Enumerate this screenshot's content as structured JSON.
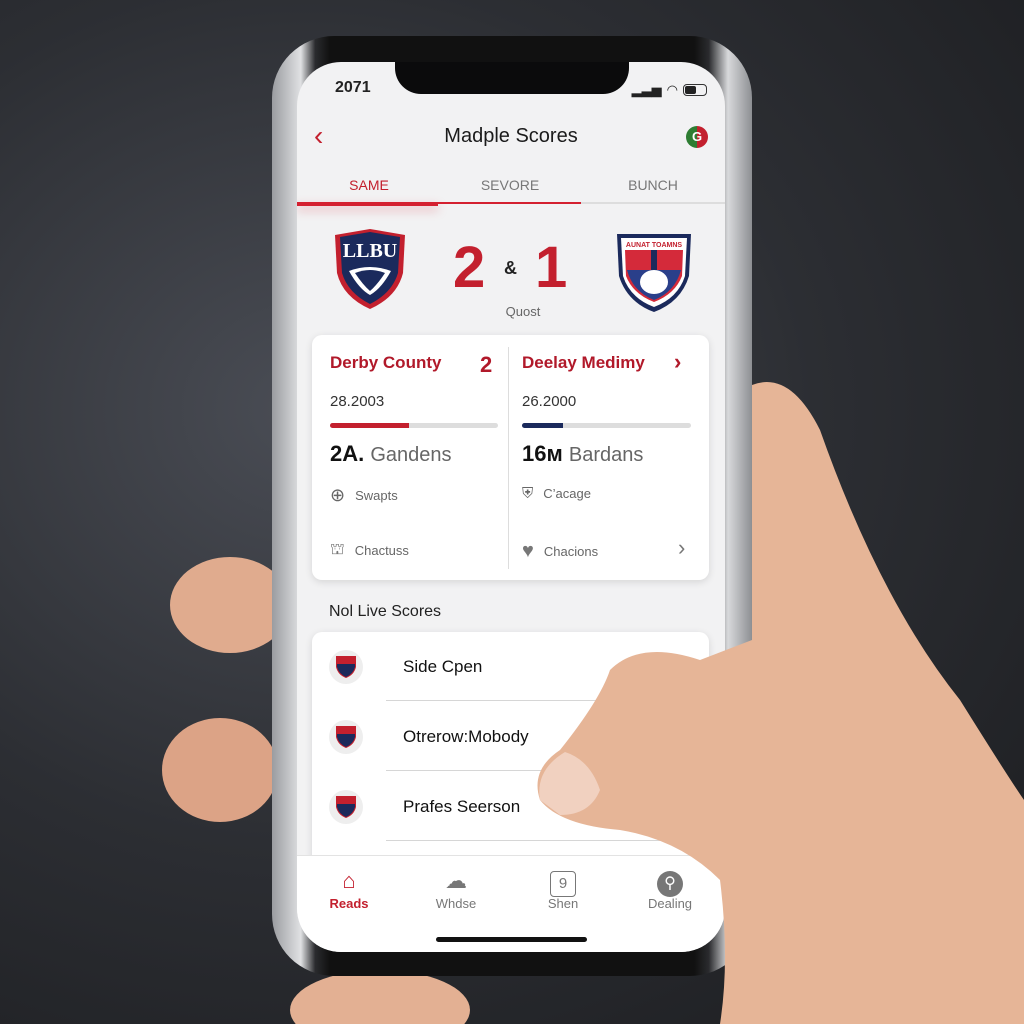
{
  "status": {
    "time": "2071"
  },
  "header": {
    "title": "Madple Scores",
    "back_icon": "chevron-left-icon",
    "profile_icon_letter": "G"
  },
  "tabs": [
    {
      "label": "SAME",
      "active": true
    },
    {
      "label": "SEVORE"
    },
    {
      "label": "BUNCH"
    }
  ],
  "match": {
    "home_logo_text": "LLBU",
    "away_logo_text": "AUNAT TOAMNS",
    "home_score": "2",
    "separator": "&",
    "away_score": "1",
    "status": "Quost"
  },
  "stats": {
    "left": {
      "team": "Derby County",
      "score": "2",
      "date": "28.2003",
      "progress": 0.47,
      "value": "2A.",
      "value_label": "Gandens",
      "item1": "Swapts",
      "item2": "Chactuss",
      "color": "#c3202e"
    },
    "right": {
      "team": "Deelay Medimy",
      "date": "26.2000",
      "progress": 0.24,
      "value": "16м",
      "value_label": "Bardans",
      "item1": "C’acage",
      "item2": "Chacions",
      "color": "#1b2a5c"
    }
  },
  "live": {
    "title": "Nol Live Scores",
    "items": [
      {
        "name": "Side Cpen"
      },
      {
        "name": "Otrerow:Mobody"
      },
      {
        "name": "Prafes Seerson"
      }
    ]
  },
  "nav": [
    {
      "label": "Reads",
      "icon": "home-icon",
      "active": true
    },
    {
      "label": "Whdse",
      "icon": "people-icon"
    },
    {
      "label": "Shen",
      "icon": "badge-icon",
      "glyph": "9"
    },
    {
      "label": "Dealing",
      "icon": "search-icon"
    }
  ],
  "colors": {
    "accent": "#c3202e",
    "navy": "#1b2a5c"
  }
}
